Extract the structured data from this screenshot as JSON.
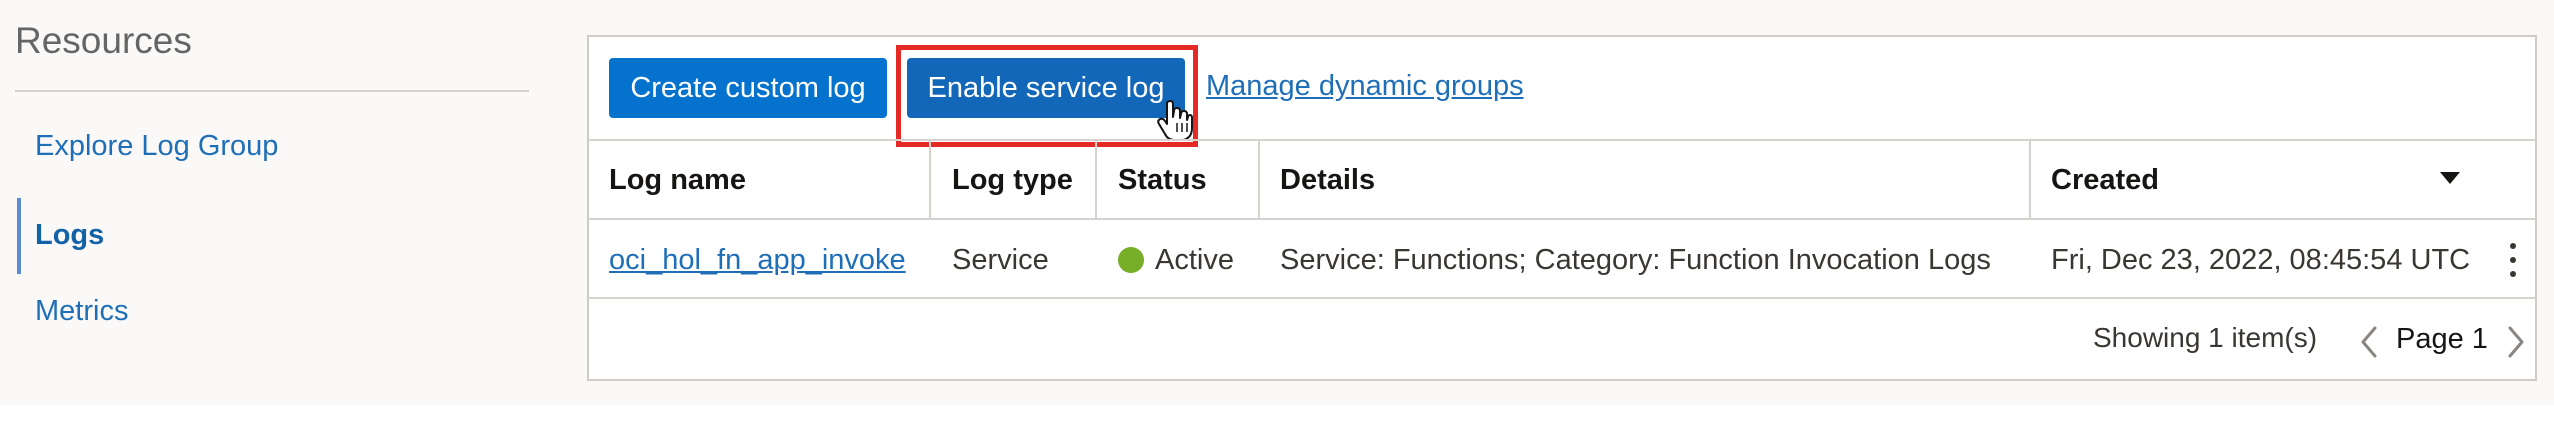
{
  "resources": {
    "title": "Resources",
    "items": [
      {
        "label": "Explore Log Group",
        "active": false
      },
      {
        "label": "Logs",
        "active": true
      },
      {
        "label": "Metrics",
        "active": false
      }
    ]
  },
  "toolbar": {
    "create_label": "Create custom log",
    "enable_label": "Enable service log",
    "manage_label": "Manage dynamic groups"
  },
  "table": {
    "columns": [
      "Log name",
      "Log type",
      "Status",
      "Details",
      "Created"
    ],
    "rows": [
      {
        "log_name": "oci_hol_fn_app_invoke",
        "log_type": "Service",
        "status": "Active",
        "details": "Service: Functions; Category: Function Invocation Logs",
        "created": "Fri, Dec 23, 2022, 08:45:54 UTC"
      }
    ]
  },
  "pagination": {
    "showing": "Showing 1 item(s)",
    "page": "Page 1"
  },
  "colors": {
    "primary_button": "#0572ce",
    "highlight": "#e52a25",
    "link": "#1f6fb8",
    "status_active": "#76ae27"
  },
  "icons": {
    "cursor": "hand-pointer-icon",
    "sort": "caret-down-icon",
    "row_actions": "kebab-menu-icon",
    "prev": "chevron-left-icon",
    "next": "chevron-right-icon"
  }
}
